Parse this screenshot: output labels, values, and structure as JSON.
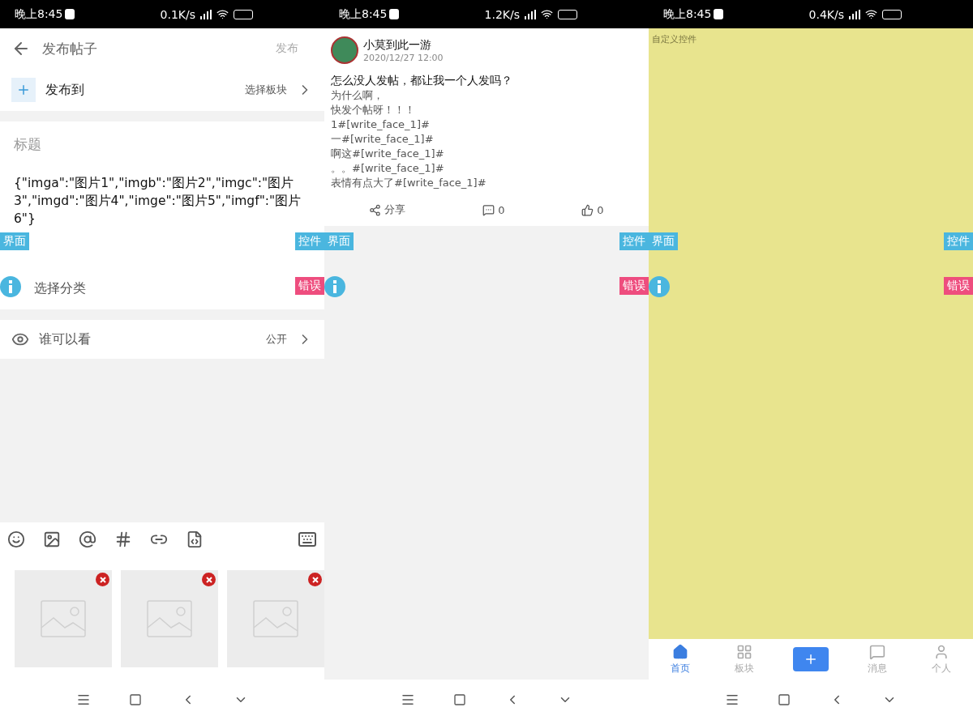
{
  "status_bars": [
    {
      "time": "晚上8:45",
      "speed": "0.1K/s"
    },
    {
      "time": "晚上8:45",
      "speed": "1.2K/s"
    },
    {
      "time": "晚上8:45",
      "speed": "0.4K/s"
    }
  ],
  "composer": {
    "title": "发布帖子",
    "publish": "发布",
    "post_to": {
      "label": "发布到",
      "value": "选择板块"
    },
    "title_placeholder": "标题",
    "body": "{\"imga\":\"图片1\",\"imgb\":\"图片2\",\"imgc\":\"图片3\",\"imgd\":\"图片4\",\"imge\":\"图片5\",\"imgf\":\"图片6\"}",
    "category": "选择分类",
    "visibility": {
      "label": "谁可以看",
      "value": "公开"
    }
  },
  "post": {
    "author": "小莫到此一游",
    "date": "2020/12/27 12:00",
    "title": "怎么没人发帖，都让我一个人发吗？",
    "lines": [
      "为什么啊，",
      "快发个帖呀！！！",
      "1#[write_face_1]#",
      "一#[write_face_1]#",
      "啊这#[write_face_1]#",
      "。。#[write_face_1]#",
      "表情有点大了#[write_face_1]#"
    ],
    "share": "分享",
    "comments": "0",
    "likes": "0"
  },
  "custom_view": {
    "label": "自定义控件"
  },
  "tab_bar": [
    {
      "label": "首页",
      "selected": true
    },
    {
      "label": "板块",
      "selected": false
    },
    {
      "label": "消息",
      "selected": false
    },
    {
      "label": "个人",
      "selected": false
    }
  ],
  "debug_overlays": [
    {
      "left": "界面",
      "right": "控件",
      "error": "错误"
    },
    {
      "left": "界面",
      "right": "控件",
      "error": "错误"
    },
    {
      "left": "界面",
      "right": "控件",
      "error": "错误"
    }
  ]
}
